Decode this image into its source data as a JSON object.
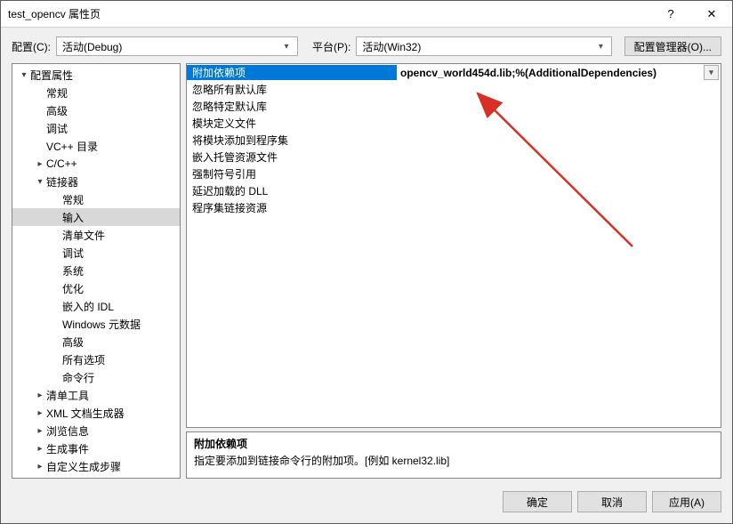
{
  "window": {
    "title": "test_opencv 属性页"
  },
  "titlebar_icons": {
    "help": "?",
    "close": "✕"
  },
  "toolbar": {
    "config_label": "配置(C):",
    "config_value": "活动(Debug)",
    "platform_label": "平台(P):",
    "platform_value": "活动(Win32)",
    "manager_btn": "配置管理器(O)..."
  },
  "tree": [
    {
      "label": "配置属性",
      "depth": 0,
      "exp": "▾"
    },
    {
      "label": "常规",
      "depth": 1
    },
    {
      "label": "高级",
      "depth": 1
    },
    {
      "label": "调试",
      "depth": 1
    },
    {
      "label": "VC++ 目录",
      "depth": 1
    },
    {
      "label": "C/C++",
      "depth": 1,
      "exp": "▸"
    },
    {
      "label": "链接器",
      "depth": 1,
      "exp": "▾"
    },
    {
      "label": "常规",
      "depth": 2
    },
    {
      "label": "输入",
      "depth": 2,
      "selected": true
    },
    {
      "label": "清单文件",
      "depth": 2
    },
    {
      "label": "调试",
      "depth": 2
    },
    {
      "label": "系统",
      "depth": 2
    },
    {
      "label": "优化",
      "depth": 2
    },
    {
      "label": "嵌入的 IDL",
      "depth": 2
    },
    {
      "label": "Windows 元数据",
      "depth": 2
    },
    {
      "label": "高级",
      "depth": 2
    },
    {
      "label": "所有选项",
      "depth": 2
    },
    {
      "label": "命令行",
      "depth": 2
    },
    {
      "label": "清单工具",
      "depth": 1,
      "exp": "▸"
    },
    {
      "label": "XML 文档生成器",
      "depth": 1,
      "exp": "▸"
    },
    {
      "label": "浏览信息",
      "depth": 1,
      "exp": "▸"
    },
    {
      "label": "生成事件",
      "depth": 1,
      "exp": "▸"
    },
    {
      "label": "自定义生成步骤",
      "depth": 1,
      "exp": "▸"
    }
  ],
  "grid": [
    {
      "label": "附加依赖项",
      "value": "opencv_world454d.lib;%(AdditionalDependencies)",
      "selected": true
    },
    {
      "label": "忽略所有默认库",
      "value": ""
    },
    {
      "label": "忽略特定默认库",
      "value": ""
    },
    {
      "label": "模块定义文件",
      "value": ""
    },
    {
      "label": "将模块添加到程序集",
      "value": ""
    },
    {
      "label": "嵌入托管资源文件",
      "value": ""
    },
    {
      "label": "强制符号引用",
      "value": ""
    },
    {
      "label": "延迟加载的 DLL",
      "value": ""
    },
    {
      "label": "程序集链接资源",
      "value": ""
    }
  ],
  "desc": {
    "title": "附加依赖项",
    "text": "指定要添加到链接命令行的附加项。[例如 kernel32.lib]"
  },
  "footer": {
    "ok": "确定",
    "cancel": "取消",
    "apply": "应用(A)"
  },
  "arrow_color": "#d93025"
}
